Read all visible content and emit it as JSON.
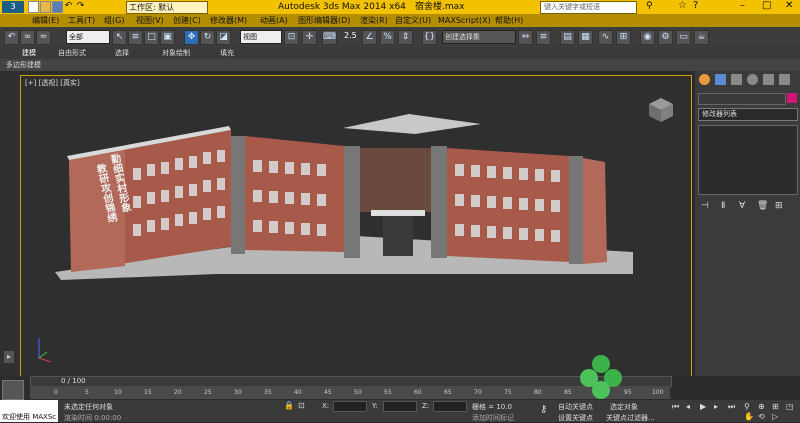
{
  "titlebar": {
    "workspace_label": "工作区: 默认",
    "app_title": "Autodesk 3ds Max  2014 x64",
    "file_name": "宿舍楼.max",
    "search_placeholder": "键入关键字或短语"
  },
  "menu": [
    "编辑(E)",
    "工具(T)",
    "组(G)",
    "视图(V)",
    "创建(C)",
    "修改器(M)",
    "动画(A)",
    "图形编辑器(D)",
    "渲染(R)",
    "自定义(U)",
    "MAXScript(X)",
    "帮助(H)"
  ],
  "toolbar": {
    "selection_filter": "全部",
    "ref_coord": "视图",
    "snap_value": "2.5",
    "named_selection": "创建选择集"
  },
  "ribbon_tabs": [
    "建模",
    "自由形式",
    "选择",
    "对象绘制",
    "填充"
  ],
  "ribbon_sub": "多边形建模",
  "viewport": {
    "label": "[+] [透视] [真实]"
  },
  "building_sign": {
    "col1": "勤细实村形象",
    "col2": "教研攻创锦绣"
  },
  "command_panel": {
    "modifier_list": "修改器列表"
  },
  "timeline": {
    "frame_display": "0 / 100",
    "ticks": [
      "0",
      "5",
      "10",
      "15",
      "20",
      "25",
      "30",
      "35",
      "40",
      "45",
      "50",
      "55",
      "60",
      "65",
      "70",
      "75",
      "80",
      "85",
      "90",
      "95",
      "100"
    ]
  },
  "status": {
    "maxscript_label": "欢迎使用 MAXSc",
    "selection_status": "未选定任何对象",
    "prompt_text": "渲染时间 0:00:00",
    "x_label": "X:",
    "y_label": "Y:",
    "z_label": "Z:",
    "grid_label": "栅格 = 10.0",
    "add_time_tag": "添加时间标记",
    "auto_key": "自动关键点",
    "set_key": "设置关键点",
    "selected_dropdown": "选定对象",
    "key_filters": "关键点过滤器..."
  },
  "colors": {
    "title_yellow": "#f2c200",
    "menu_gold": "#b58d00",
    "viewport_border": "#c9a400",
    "brick": "#a85a4a"
  }
}
